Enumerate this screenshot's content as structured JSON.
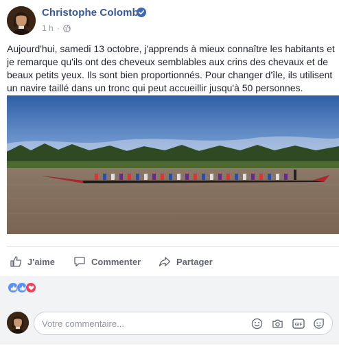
{
  "post": {
    "author": "Christophe Colomb",
    "time": "1 h",
    "separator": "·",
    "text": "Aujourd'hui, samedi 13 octobre, j'apprends à mieux connaître les habitants et je remarque qu'ils ont des cheveux semblables aux crins des chevaux et de beaux petits yeux. Ils sont bien proportionnés. Pour changer d'île, ils utilisent un navire taillé dans un tronc qui peut accueillir jusqu'à 50 personnes."
  },
  "actions": {
    "like": "J'aime",
    "comment": "Commenter",
    "share": "Partager"
  },
  "reactions": [
    "like-icon",
    "love-icon"
  ],
  "comment": {
    "placeholder": "Votre commentaire..."
  },
  "colors": {
    "author_link": "#365899",
    "meta_gray": "#90949c",
    "action_gray": "#606770",
    "verified_blue": "#4267b2",
    "like_blue": "#1877f2",
    "love_red": "#f33e58",
    "panel_bg": "#f2f3f5"
  }
}
